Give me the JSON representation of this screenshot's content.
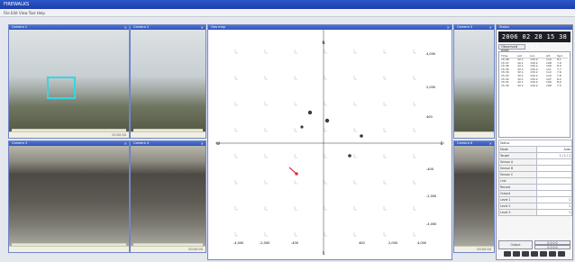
{
  "window": {
    "title": "FIREWALKS"
  },
  "menu": {
    "text": "File  Edit  View  Tool  Help"
  },
  "cameras": [
    {
      "title": "Camera 1",
      "footer": "00:00:00"
    },
    {
      "title": "Camera 2",
      "footer": ""
    },
    {
      "title": "Camera 3",
      "footer": ""
    },
    {
      "title": "Camera 4",
      "footer": "00:00:00"
    },
    {
      "title": "Camera 5",
      "footer": ""
    },
    {
      "title": "Camera 6",
      "footer": "00:00:00"
    }
  ],
  "map": {
    "title": "Geo map",
    "top_marker": "N",
    "left_marker": "W",
    "right_marker": "E",
    "bottom_marker": "S",
    "right_ticks": [
      "4,000",
      "2,000",
      "400",
      "-400",
      "-2,000",
      "-4,000"
    ],
    "bottom_ticks": [
      "-4,000",
      "-2,000",
      "-400",
      "400",
      "2,000",
      "4,000"
    ],
    "grid_cols": 7,
    "grid_rows": 8
  },
  "panel": {
    "title": "Status",
    "clock": "2006 02 28  15 38 52",
    "section": "Observed data",
    "table_headers": [
      "Time",
      "Lat",
      "Lon",
      "Alt",
      "Spd"
    ],
    "table_rows": [
      [
        "15:38",
        "32.1",
        "130.2",
        "110",
        "8.1"
      ],
      [
        "15:37",
        "32.1",
        "130.2",
        "108",
        "7.9"
      ],
      [
        "15:36",
        "32.1",
        "130.2",
        "109",
        "8.0"
      ],
      [
        "15:35",
        "32.1",
        "130.2",
        "111",
        "7.7"
      ],
      [
        "15:34",
        "32.1",
        "130.2",
        "112",
        "7.6"
      ],
      [
        "15:33",
        "32.1",
        "130.2",
        "110",
        "7.8"
      ],
      [
        "15:32",
        "32.1",
        "130.2",
        "107",
        "8.2"
      ],
      [
        "15:31",
        "32.1",
        "130.2",
        "106",
        "8.0"
      ],
      [
        "15:30",
        "32.1",
        "130.2",
        "108",
        "7.5"
      ]
    ],
    "info_header": "Status",
    "info_rows": [
      {
        "k": "Mode",
        "v": "Auto"
      },
      {
        "k": "Target",
        "v": "1 / 1 / 1"
      },
      {
        "k": "Sensor A",
        "v": ""
      },
      {
        "k": "Sensor B",
        "v": ""
      },
      {
        "k": "Sensor C",
        "v": ""
      },
      {
        "k": "Link",
        "v": ""
      },
      {
        "k": "Record",
        "v": ""
      },
      {
        "k": "Output",
        "v": ""
      },
      {
        "k": "Level 1",
        "v": "1"
      },
      {
        "k": "Level 2",
        "v": "1"
      },
      {
        "k": "Level 3",
        "v": "1"
      }
    ],
    "action_label": "Output",
    "action_values": [
      "0 0 0 0",
      "0 0 0 0"
    ]
  },
  "colors": {
    "accent": "#2f55b9",
    "roi": "#35d6e3",
    "target": "#d8344a"
  }
}
